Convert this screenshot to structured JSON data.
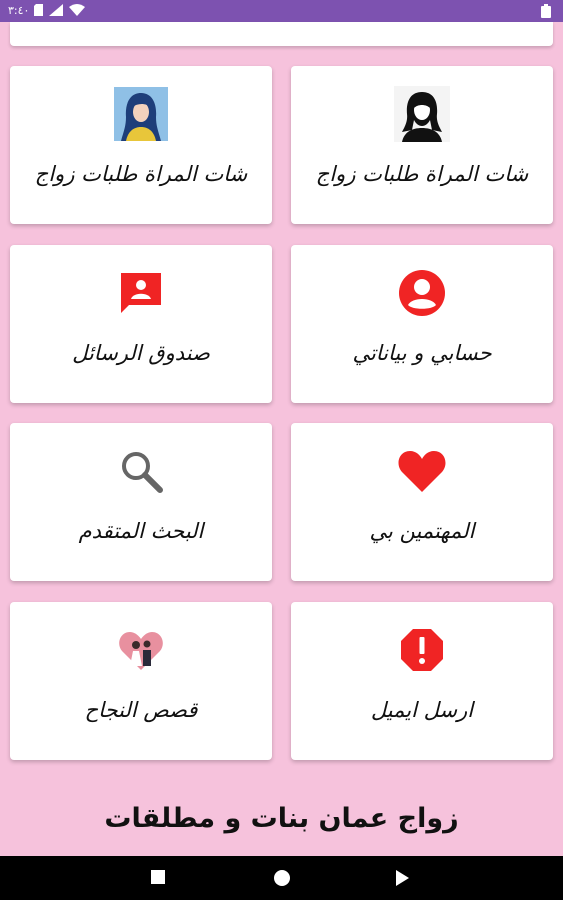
{
  "status_bar": {
    "time": "٣:٤٠"
  },
  "cards": [
    {
      "label": "شات المراة طلبات زواج",
      "icon": "woman-silhouette-icon"
    },
    {
      "label": "شات المراة طلبات زواج",
      "icon": "woman-portrait-icon"
    },
    {
      "label": "حسابي و بياناتي",
      "icon": "account-circle-icon"
    },
    {
      "label": "صندوق الرسائل",
      "icon": "message-inbox-icon"
    },
    {
      "label": "المهتمين بي",
      "icon": "heart-icon"
    },
    {
      "label": "البحث المتقدم",
      "icon": "search-icon"
    },
    {
      "label": "ارسل ايميل",
      "icon": "alert-octagon-icon"
    },
    {
      "label": "قصص النجاح",
      "icon": "couple-heart-icon"
    }
  ],
  "app_title": "زواج عمان بنات و مطلقات",
  "colors": {
    "status_bar": "#7d52b0",
    "background": "#f6c2dc",
    "accent_red": "#f02424"
  }
}
